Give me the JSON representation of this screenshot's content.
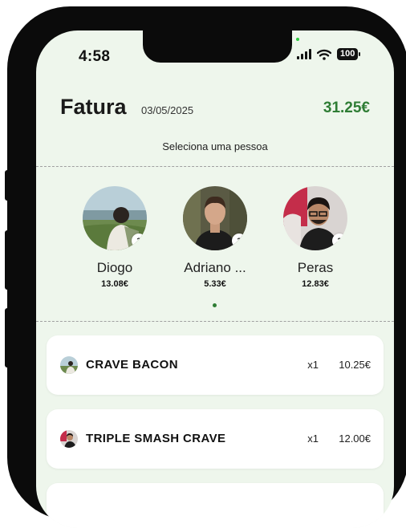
{
  "status_bar": {
    "time": "4:58",
    "battery": "100"
  },
  "header": {
    "title": "Fatura",
    "date": "03/05/2025",
    "total": "31.25€"
  },
  "people_section": {
    "subtitle": "Seleciona uma pessoa",
    "people": [
      {
        "name": "Diogo",
        "amount": "13.08€",
        "count": "3"
      },
      {
        "name": "Adriano ...",
        "amount": "5.33€",
        "count": "3"
      },
      {
        "name": "Peras",
        "amount": "12.83€",
        "count": "2"
      }
    ]
  },
  "items": [
    {
      "name": "CRAVE BACON",
      "qty": "x1",
      "price": "10.25€"
    },
    {
      "name": "TRIPLE SMASH CRAVE",
      "qty": "x1",
      "price": "12.00€"
    }
  ],
  "colors": {
    "accent": "#2f7d35",
    "background": "#eef6ec",
    "card": "#ffffff"
  }
}
